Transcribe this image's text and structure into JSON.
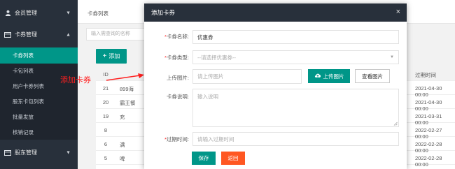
{
  "sidebar": {
    "groups": [
      {
        "label": "会员管理",
        "icon": "user-icon"
      },
      {
        "label": "卡券管理",
        "icon": "card-icon"
      },
      {
        "label": "股东管理",
        "icon": "card-icon"
      }
    ],
    "items": [
      {
        "label": "卡券列表",
        "active": true
      },
      {
        "label": "卡包列表",
        "active": false
      },
      {
        "label": "用户卡券列表",
        "active": false
      },
      {
        "label": "股东卡包列表",
        "active": false
      },
      {
        "label": "批量发放",
        "active": false
      },
      {
        "label": "核销记录",
        "active": false
      }
    ]
  },
  "main": {
    "page_tab": "卡券列表",
    "search_placeholder": "输入需查询的名称",
    "add_button": "添加",
    "table": {
      "header_id": "ID",
      "header_expire": "过期时间",
      "rows": [
        {
          "id": "21",
          "name": "899海",
          "expire": "2021-04-30 00:00"
        },
        {
          "id": "20",
          "name": "霸王餐",
          "expire": "2021-04-30 00:00"
        },
        {
          "id": "19",
          "name": "充",
          "expire": "2021-03-31 00:00"
        },
        {
          "id": "8",
          "name": "",
          "expire": "2022-02-27 00:00"
        },
        {
          "id": "6",
          "name": "满",
          "expire": "2022-02-28 00:00"
        },
        {
          "id": "5",
          "name": "啤",
          "expire": "2022-02-28 00:00"
        }
      ]
    }
  },
  "annotation": {
    "text": "添加卡券",
    "color": "#ff2020"
  },
  "modal": {
    "title": "添加卡券",
    "close": "×",
    "fields": {
      "name_label": "卡券名称:",
      "name_value": "优惠券",
      "type_label": "卡券类型:",
      "type_placeholder": "--请选择优惠券--",
      "image_label": "上传图片:",
      "image_placeholder": "请上传图片",
      "upload_button": "上传图片",
      "view_button": "查看图片",
      "desc_label": "卡券说明:",
      "desc_placeholder": "输入说明",
      "expire_label": "过期时间:",
      "expire_placeholder": "请输入过期时间"
    },
    "save_button": "保存",
    "back_button": "返回"
  },
  "colors": {
    "accent": "#009688",
    "sidebar": "#28303b",
    "danger": "#ff5722"
  }
}
